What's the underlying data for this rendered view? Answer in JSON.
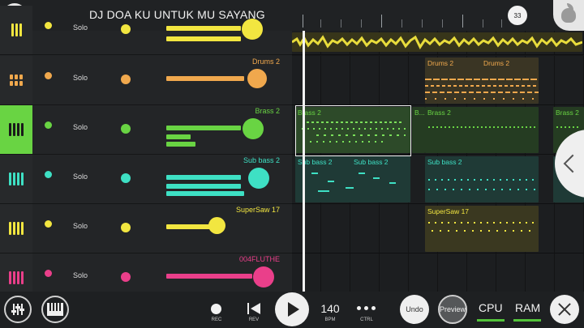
{
  "header": {
    "title": "DJ DOA KU UNTUK MU SAYANG",
    "position_badge": "33"
  },
  "tracks": [
    {
      "name": "",
      "solo": "Solo",
      "color": "#f2e640"
    },
    {
      "name": "Drums 2",
      "solo": "Solo",
      "color": "#f0a84d"
    },
    {
      "name": "Brass 2",
      "solo": "Solo",
      "color": "#69d443"
    },
    {
      "name": "Sub bass 2",
      "solo": "Solo",
      "color": "#3ee0c4"
    },
    {
      "name": "SuperSaw 17",
      "solo": "Solo",
      "color": "#f2e640"
    },
    {
      "name": "004FLUTHE",
      "solo": "Solo",
      "color": "#ea3f8a"
    }
  ],
  "clips": {
    "drums_1": "Drums 2",
    "drums_2": "Drums 2",
    "brass_1": "Brass 2",
    "brass_2": "B...",
    "brass_3": "Brass 2",
    "brass_4": "Brass 2",
    "subbass_1": "Sub bass 2",
    "subbass_2": "Sub bass 2",
    "subbass_3": "Sub bass 2",
    "supersaw_1": "SuperSaw 17"
  },
  "transport": {
    "rec_label": "REC",
    "rev_label": "REV",
    "bpm": "140",
    "bpm_label": "BPM",
    "ctrl_label": "CTRL",
    "undo": "Undo",
    "preview": "Preview",
    "cpu": "CPU",
    "ram": "RAM"
  },
  "colors": {
    "accent_green": "#69d443",
    "background": "#1b1d1f"
  },
  "icons": [
    "menu-icon",
    "fl-logo-icon",
    "mixer-icon",
    "piano-icon",
    "record-icon",
    "reverse-icon",
    "play-icon",
    "close-icon",
    "chevron-left-icon"
  ]
}
